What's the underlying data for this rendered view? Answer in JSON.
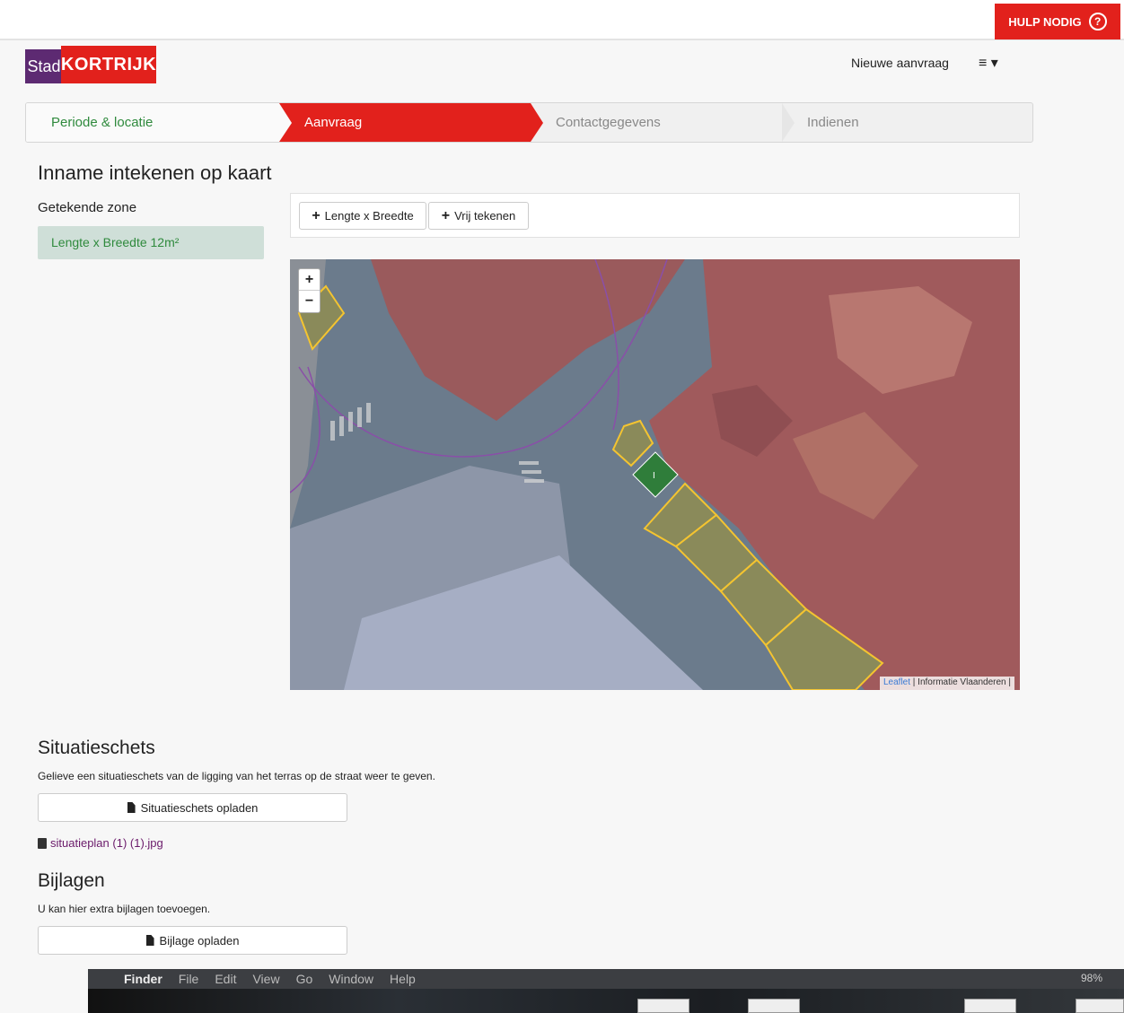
{
  "header": {
    "help_label": "HULP NODIG",
    "help_icon": "question-circle-icon",
    "logo": {
      "stad": "Stad",
      "kortrijk": "KORTRIJK"
    },
    "nav_new_request": "Nieuwe aanvraag",
    "nav_menu": "≡ ▾"
  },
  "steps": [
    {
      "label": "Periode & locatie",
      "state": "done"
    },
    {
      "label": "Aanvraag",
      "state": "active"
    },
    {
      "label": "Contactgegevens",
      "state": "todo"
    },
    {
      "label": "Indienen",
      "state": "todo"
    }
  ],
  "page": {
    "title": "Inname intekenen op kaart",
    "zone_label": "Getekende zone",
    "zone_item": "Lengte x Breedte 12m²"
  },
  "toolbar": {
    "btn_length_width": "Lengte x Breedte",
    "btn_free_draw": "Vrij tekenen"
  },
  "map": {
    "zoom_in": "+",
    "zoom_out": "−",
    "attribution_link": "Leaflet",
    "attribution_text": " | Informatie Vlaanderen |",
    "marker_label": "I",
    "colors": {
      "buildings": "#a0585a",
      "road": "#63778c",
      "zone_outline": "#f4c430",
      "marker": "#2f7d3a"
    }
  },
  "situatieschets": {
    "title": "Situatieschets",
    "text": "Gelieve een situatieschets van de ligging van het terras op de straat weer te geven.",
    "button": "Situatieschets opladen",
    "file": "situatieplan (1) (1).jpg"
  },
  "bijlagen": {
    "title": "Bijlagen",
    "text": "U kan hier extra bijlagen toevoegen.",
    "button": "Bijlage opladen"
  },
  "macos_menubar": {
    "app": "Finder",
    "items": [
      "File",
      "Edit",
      "View",
      "Go",
      "Window",
      "Help"
    ],
    "battery": "98%"
  }
}
